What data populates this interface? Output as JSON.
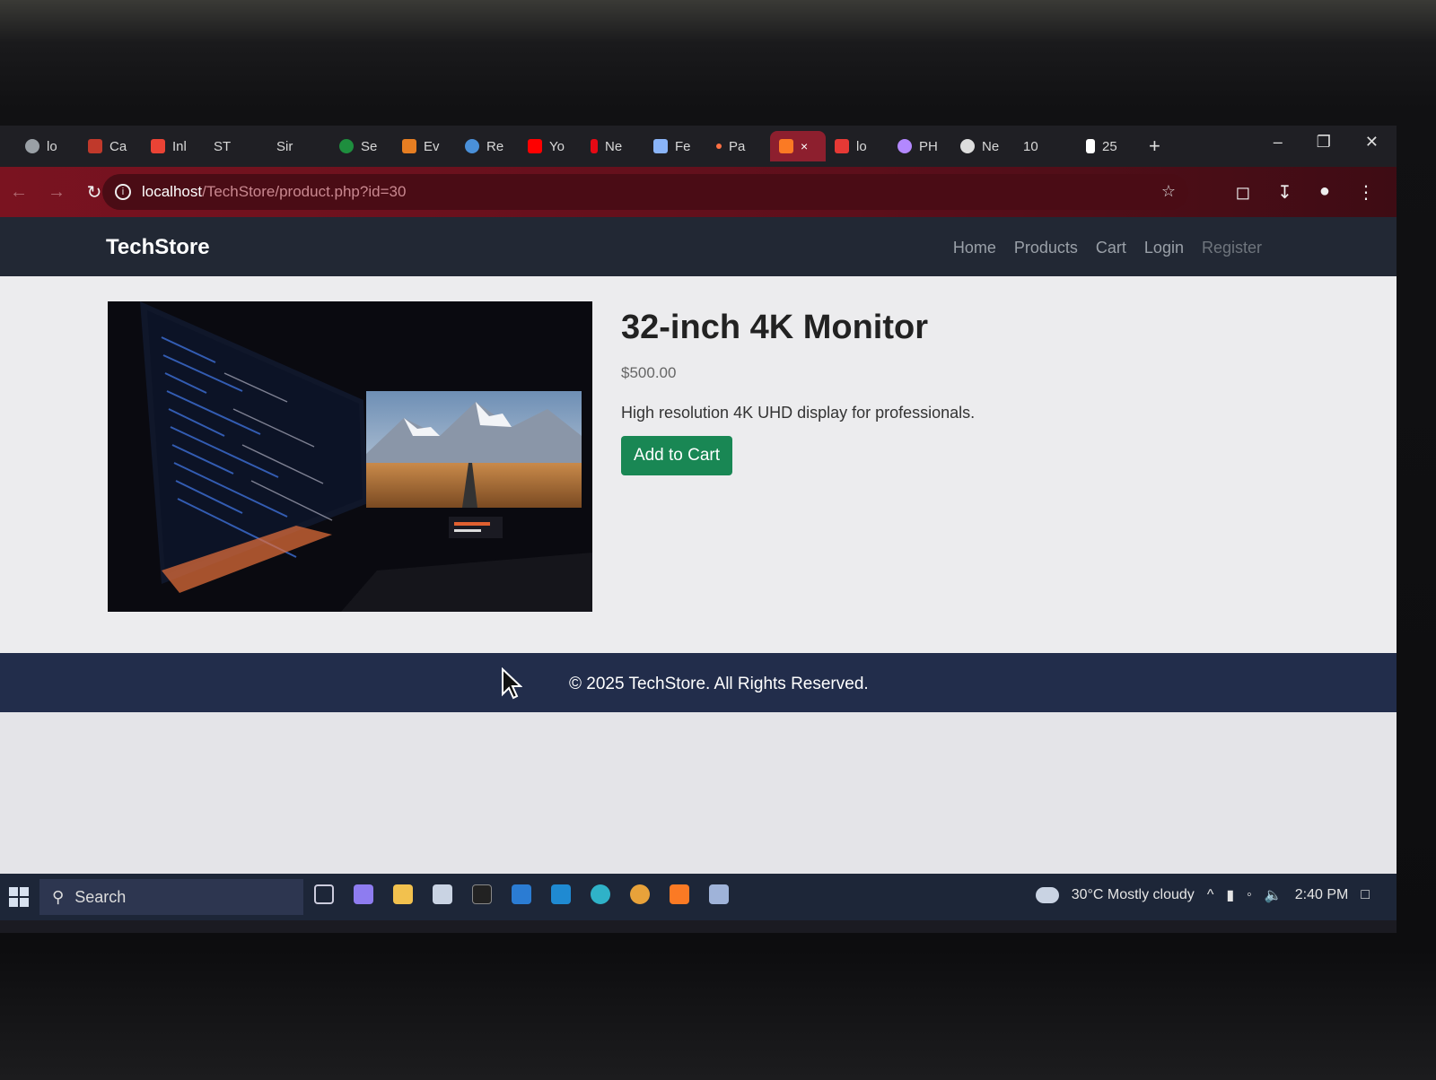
{
  "browser": {
    "tabs": [
      {
        "label": "lo",
        "color": "#9aa0a6"
      },
      {
        "label": "Ca",
        "color": "#c0392b"
      },
      {
        "label": "Inl",
        "color": "#ea4335"
      },
      {
        "label": "ST",
        "color": "#444444"
      },
      {
        "label": "Sir",
        "color": "#444444"
      },
      {
        "label": "Se",
        "color": "#1e8e3e"
      },
      {
        "label": "Ev",
        "color": "#e67e22"
      },
      {
        "label": "Re",
        "color": "#4a90d9"
      },
      {
        "label": "Yo",
        "color": "#ff0000"
      },
      {
        "label": "Ne",
        "color": "#e50914"
      },
      {
        "label": "Fe",
        "color": "#8ab4f8"
      },
      {
        "label": "Pa",
        "color": "#ff7043"
      },
      {
        "label": "lo",
        "color": "#e53935"
      },
      {
        "label": "PH",
        "color": "#b388ff"
      },
      {
        "label": "Ne",
        "color": "#dddddd"
      },
      {
        "label": "10",
        "color": "#444444"
      },
      {
        "label": "25",
        "color": "#ffffff"
      }
    ],
    "active_tab_close": "×",
    "new_tab": "+",
    "url_host": "localhost",
    "url_path": "/TechStore/product.php?id=30"
  },
  "site": {
    "brand": "TechStore",
    "nav": [
      "Home",
      "Products",
      "Cart",
      "Login",
      "Register"
    ]
  },
  "product": {
    "title": "32-inch 4K Monitor",
    "price": "$500.00",
    "description": "High resolution 4K UHD display for professionals.",
    "add_to_cart": "Add to Cart"
  },
  "footer": {
    "text": "© 2025 TechStore. All Rights Reserved."
  },
  "taskbar": {
    "search_label": "Search",
    "weather": "30°C  Mostly cloudy",
    "time": "2:40 PM"
  }
}
